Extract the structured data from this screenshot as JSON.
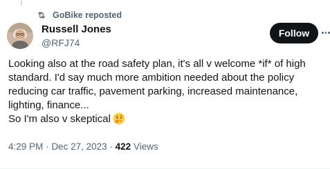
{
  "repost": {
    "label": "GoBike reposted",
    "icon": "repost-icon"
  },
  "author": {
    "name": "Russell Jones",
    "handle": "@RFJ74",
    "avatar_icon": "user-avatar"
  },
  "follow_button": {
    "label": "Follow"
  },
  "more_menu": {
    "icon": "more-horizontal-icon"
  },
  "post": {
    "lines": [
      "Looking also at the road safety plan,  it's all v welcome *if* of high",
      "standard. I'd say much more ambition needed about the policy",
      "reducing car traffic,  pavement parking, increased maintenance,",
      "lighting, finance...",
      "So I'm also v skeptical"
    ],
    "emoji_icon": "thinking-face-emoji"
  },
  "meta": {
    "time": "4:29 PM",
    "separator": "·",
    "date": "Dec 27, 2023",
    "views_count": "422",
    "views_label": "Views"
  },
  "colors": {
    "text_primary": "#0f1419",
    "text_secondary": "#536471",
    "button_bg": "#0f1419",
    "button_text": "#ffffff"
  }
}
